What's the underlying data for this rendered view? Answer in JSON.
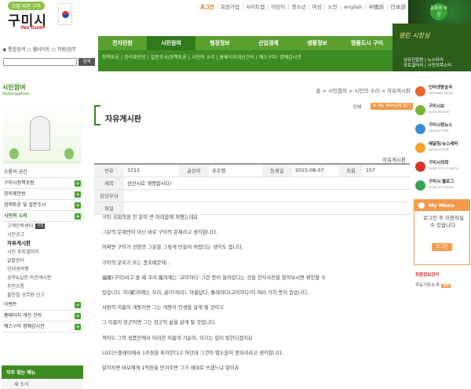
{
  "header": {
    "logo_tag": "으뜸 비전 구미",
    "logo_name": "구미시",
    "logo_sub": "Yes Gumi",
    "top_links": [
      "로그인",
      "회원가입",
      "사이트맵",
      "어린이",
      "청소년",
      "여성",
      "노인",
      "english",
      "中國語",
      "日本語"
    ],
    "badge": "문화와 부강",
    "search": {
      "options": [
        "통합검색",
        "웹사이트",
        "직원/업무"
      ],
      "button": "검색"
    }
  },
  "nav": {
    "items": [
      "전자민원",
      "시민참여",
      "행정정보",
      "산업경제",
      "생활정보",
      "명품도시 구미"
    ],
    "active": 1,
    "sub_items": [
      "정책토론",
      "창의제안방",
      "설문조사/정책토론",
      "시민의 소리",
      "홈페이지개선건의",
      "예스구미! 명예감시관"
    ],
    "right_title": "열린 시장실",
    "right_links": [
      "남유진칼럼 | 뉴스타리",
      "포토갤러리 | 시민의목소리"
    ]
  },
  "sidebar": {
    "title": "시민참여",
    "subtitle": "Participation",
    "items": [
      {
        "label": "소통의 공간",
        "type": "item",
        "plus": false
      },
      {
        "label": "구미시정책포럼",
        "type": "item",
        "plus": true
      },
      {
        "label": "창의제안방",
        "type": "item",
        "plus": true
      },
      {
        "label": "정책토론 및 설문조사",
        "type": "item",
        "plus": true
      },
      {
        "label": "시민의 소리",
        "type": "section",
        "plus": true
      },
      {
        "label": "고객만족센터",
        "type": "sub",
        "tag": "신청"
      },
      {
        "label": "시민공고",
        "type": "sub"
      },
      {
        "label": "자유게시판",
        "type": "sub",
        "current": true
      },
      {
        "label": "시민 포토갤러리",
        "type": "sub"
      },
      {
        "label": "알뜰장터",
        "type": "sub"
      },
      {
        "label": "인터넷여행",
        "type": "sub"
      },
      {
        "label": "공약&실천 의견게시판",
        "type": "sub"
      },
      {
        "label": "주민소통",
        "type": "sub"
      },
      {
        "label": "불친절 공무원 신고",
        "type": "sub"
      },
      {
        "label": "이벤트",
        "type": "item",
        "plus": true
      },
      {
        "label": "홈페이지 개선 건의",
        "type": "item",
        "plus": true
      },
      {
        "label": "예스구미 명예감시관",
        "type": "item",
        "plus": true
      }
    ],
    "quick_title": "자주 찾는 메뉴",
    "quick_first": "새 소식"
  },
  "content": {
    "breadcrumb": "홈 > 시민참여 > 시민의 소리 > 자유게시판",
    "title": "자유게시판",
    "print": "인쇄",
    "mymenu_btn": "★ My Menu에 담기",
    "board_name": "자유게시판",
    "post": {
      "no_label": "번호",
      "no": "3711",
      "author_label": "글쓴이",
      "author": "조주영",
      "date_label": "등록일",
      "date": "2015-08-07",
      "views_label": "조회",
      "views": "157",
      "subject_label": "제목",
      "subject": "선산시로 개명합시다!",
      "dept_label": "담당부서",
      "dept": "",
      "file_label": "파일",
      "file": ""
    },
    "body": [
      "구미 국회의원 한 분이 큰 어려움에 처했는데요",
      "그분의 문제만이 아닌 바로 구미의 문제라고 생각합니다.",
      "어쩌면 구미가 선량한 그분을 그렇게 만들어 버렸다는 생각도 듭니다.",
      "구미의 분위기 또는 풍조때문에...",
      "龜尾(구미)라고 쓸 때 꼬리 尾자에는 '교미하다' 그런 뜻이 들어있다는 것을 한자사전을 찾아보시면 확인할 수",
      "있습니다. 미(尾)자에는 꼬리, 끝(뜨머리), 아름답다, 흘레하다(교미하다)의 여러 가지 뜻이 있습니다.",
      "사람의 이름이 개똥이면 그는 개똥이 인생을 살게 될 것이고",
      "그 이름이 장군이면 그는 장군의 삶을 살게 될 것입니다.",
      "적어도 그의 성품안에서 이러한 이름의 기운이, 이끄는 힘이 발현되겠지요",
      "LG디스플레이에서 1조원을 투자한다고 하던데 그것이 별도움이 못되리라고 생각합니다.",
      "말하자면 바보에게 1억원을 안겨주면 그가 제대로 쓰겠느냐 말이죠"
    ]
  },
  "quickmenu": {
    "items": [
      {
        "title": "인터넷방송국",
        "sub": "INTERNET NEWS",
        "color": "#e8662b"
      },
      {
        "title": "구미시보",
        "sub": "GUMI REVIEW",
        "color": "#7bb33c"
      },
      {
        "title": "구미시청뉴스",
        "sub": "NEWSLETTER",
        "color": "#3c8bd0"
      },
      {
        "title": "배달링/뉴스레터",
        "sub": "NEWSLETTER",
        "color": "#f2a52a"
      },
      {
        "title": "구미시의회",
        "sub": "GUMI CITY COUNCIL",
        "color": "#d9342b"
      },
      {
        "title": "구미시 블로그",
        "sub": "GUMI CITY BLOG",
        "color": "#3aa551"
      }
    ],
    "mymenu_title": "My Menu",
    "mymenu_msg": "로그인 후 이용하실 수 있습니다.",
    "login_btn": "로그인",
    "member": "회원정보관리",
    "mainpage": "주요기능소개",
    "mainpage_tag": "GO"
  },
  "colors": {
    "green": "#5aa030",
    "dark_green": "#3d8c22",
    "orange": "#f49b4b"
  }
}
